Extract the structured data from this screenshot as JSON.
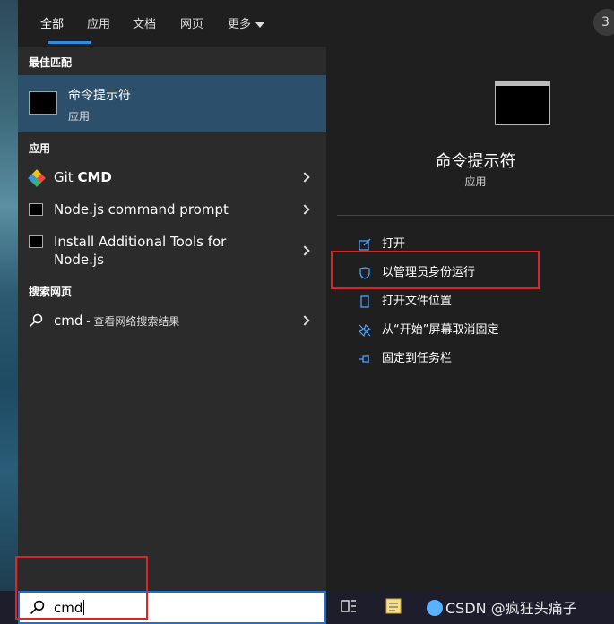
{
  "tabs": [
    {
      "label": "全部"
    },
    {
      "label": "应用"
    },
    {
      "label": "文档"
    },
    {
      "label": "网页"
    },
    {
      "label": "更多"
    }
  ],
  "badge": "3",
  "sections": {
    "best_match": "最佳匹配",
    "apps": "应用",
    "web": "搜索网页"
  },
  "best_match": {
    "title": "命令提示符",
    "subtitle": "应用"
  },
  "apps": [
    {
      "label_prefix": "Git ",
      "label_bold": "CMD"
    },
    {
      "label": "Node.js command prompt"
    },
    {
      "label_line1": "Install Additional Tools for",
      "label_line2": "Node.js"
    }
  ],
  "web_result": {
    "query": "cmd",
    "suffix": " - 查看网络搜索结果"
  },
  "details": {
    "title": "命令提示符",
    "subtitle": "应用",
    "actions": [
      {
        "label": "打开",
        "icon": "open-icon"
      },
      {
        "label": "以管理员身份运行",
        "icon": "shield-icon"
      },
      {
        "label": "打开文件位置",
        "icon": "file-location-icon"
      },
      {
        "label": "从“开始”屏幕取消固定",
        "icon": "unpin-icon"
      },
      {
        "label": "固定到任务栏",
        "icon": "pin-icon"
      }
    ]
  },
  "search": {
    "value": "cmd"
  },
  "watermark": "CSDN @疯狂头痛子"
}
